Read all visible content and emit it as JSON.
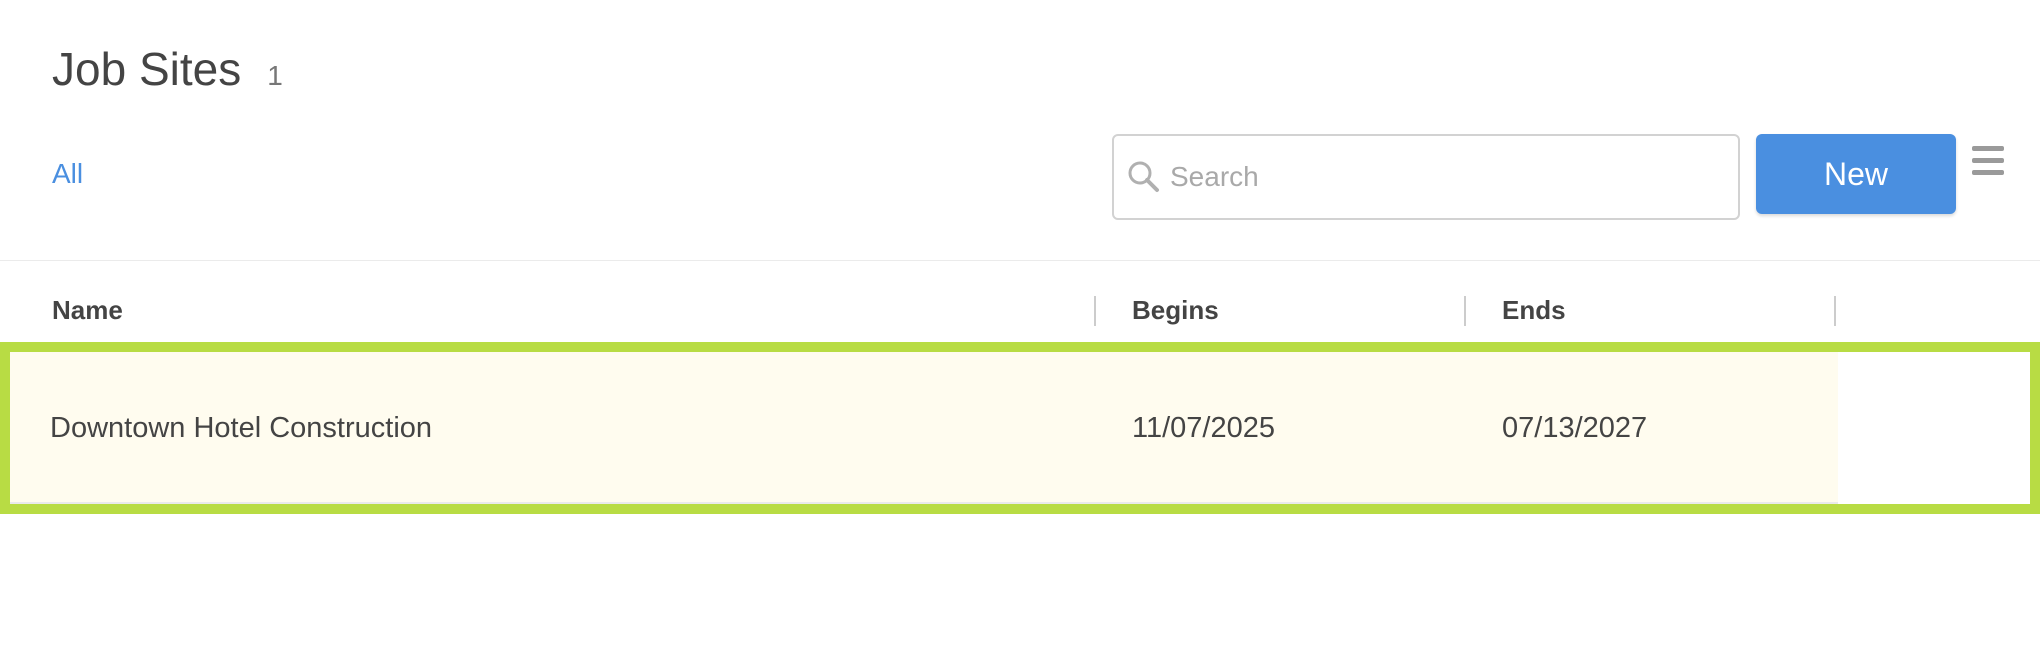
{
  "header": {
    "title": "Job Sites",
    "count": "1"
  },
  "filters": {
    "all_label": "All"
  },
  "search": {
    "placeholder": "Search",
    "value": ""
  },
  "toolbar": {
    "new_label": "New",
    "menu_icon": "hamburger-menu-icon"
  },
  "table": {
    "columns": [
      "Name",
      "Begins",
      "Ends"
    ],
    "rows": [
      {
        "name": "Downtown Hotel Construction",
        "begins": "11/07/2025",
        "ends": "07/13/2027",
        "selected": true
      }
    ]
  },
  "colors": {
    "accent": "#4a8fe0",
    "selection_outline": "#b8dc44",
    "selected_row_bg": "#fffcef"
  }
}
